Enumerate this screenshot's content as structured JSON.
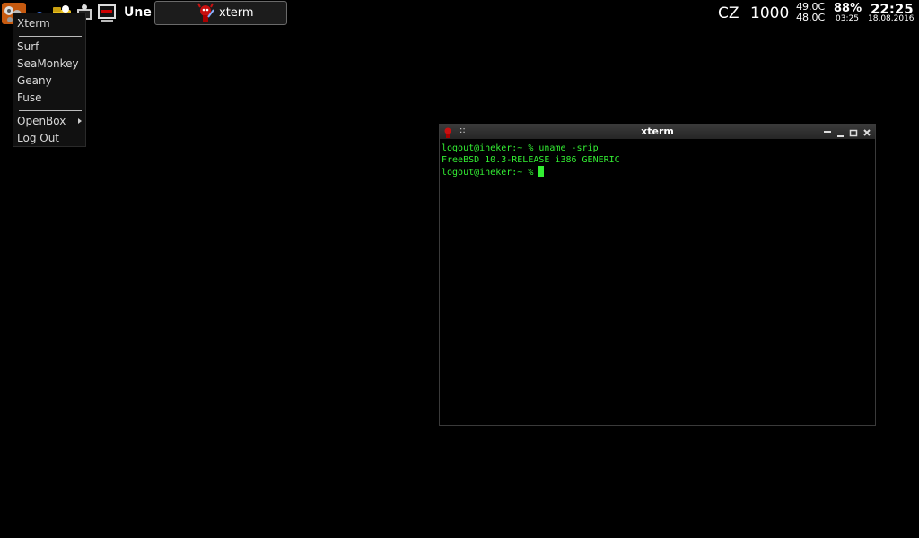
{
  "panel": {
    "launchers": [
      {
        "icon": "openbox-menu-icon"
      },
      {
        "icon": "seamonkey-browser-icon"
      },
      {
        "icon": "file-manager-icon"
      },
      {
        "icon": "terminal-icon"
      },
      {
        "icon": "xterm-icon"
      }
    ],
    "workspace_label": "Une",
    "taskbar": [
      {
        "label": "xterm",
        "icon": "beastie-icon"
      }
    ],
    "status": {
      "keyboard_layout": "CZ",
      "cpu_freq": "1000",
      "temp_1": "49.0C",
      "temp_2": "48.0C",
      "battery": "88%",
      "uptime": "03:25",
      "time": "22:25",
      "date": "18.08.2016"
    }
  },
  "menu": {
    "items": [
      "Xterm",
      "Surf",
      "SeaMonkey",
      "Geany",
      "Fuse",
      "OpenBox",
      "Log Out"
    ]
  },
  "xterm_window": {
    "title": "xterm",
    "grip_glyph": "::",
    "lines": [
      "logout@ineker:~ % uname -srip",
      "FreeBSD 10.3-RELEASE i386 GENERIC",
      "logout@ineker:~ % "
    ]
  },
  "colors": {
    "background": "#000000",
    "terminal_text": "#33ee33",
    "menu_bg": "#111111",
    "titlebar": "#2e2e2e"
  }
}
